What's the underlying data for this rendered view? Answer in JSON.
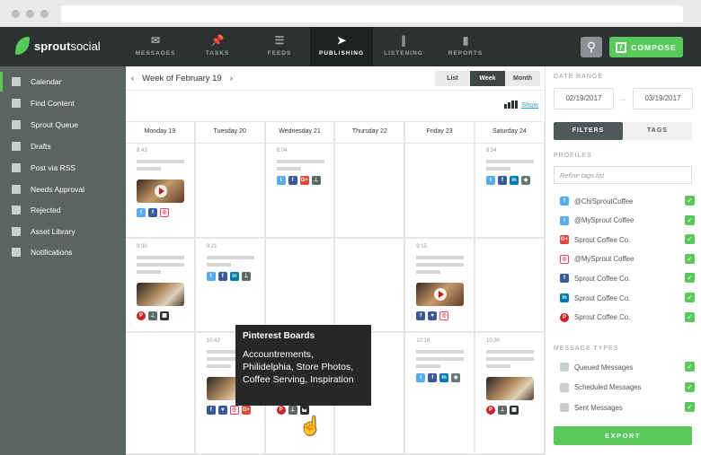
{
  "topnav": {
    "brand_a": "sprout",
    "brand_b": "social",
    "items": [
      {
        "label": "MESSAGES",
        "icon": "envelope-icon",
        "glyph": "✉"
      },
      {
        "label": "TASKS",
        "icon": "pin-icon",
        "glyph": "📌"
      },
      {
        "label": "FEEDS",
        "icon": "list-icon",
        "glyph": "☰"
      },
      {
        "label": "PUBLISHING",
        "icon": "paper-plane-icon",
        "glyph": "➤"
      },
      {
        "label": "LISTENING",
        "icon": "soundwave-icon",
        "glyph": "∥"
      },
      {
        "label": "REPORTS",
        "icon": "bar-chart-icon",
        "glyph": "▮"
      }
    ],
    "active": "PUBLISHING",
    "search_glyph": "⚲",
    "compose_label": "COMPOSE"
  },
  "sidebar": {
    "items": [
      {
        "label": "Calendar",
        "icon": "calendar-icon"
      },
      {
        "label": "Find Content",
        "icon": "binoculars-icon"
      },
      {
        "label": "Sprout Queue",
        "icon": "queue-icon"
      },
      {
        "label": "Drafts",
        "icon": "draft-icon"
      },
      {
        "label": "Post via RSS",
        "icon": "rss-icon"
      },
      {
        "label": "Needs Approval",
        "icon": "stamp-icon"
      },
      {
        "label": "Rejected",
        "icon": "rejected-icon"
      },
      {
        "label": "Asset Library",
        "icon": "library-icon"
      },
      {
        "label": "Notifications",
        "icon": "bell-icon"
      }
    ]
  },
  "calendar": {
    "prev": "‹",
    "next": "›",
    "title": "Week of February 19",
    "views": [
      "List",
      "Week",
      "Month"
    ],
    "active_view": "Week",
    "show_label": "Show",
    "days": [
      "Monday 19",
      "Tuesday 20",
      "Wednesday 21",
      "Thursday 22",
      "Friday 23",
      "Saturday 24"
    ],
    "posts": [
      {
        "day": 0,
        "row": 0,
        "time": "8:43",
        "lines": 2,
        "image": "video",
        "icons": [
          "twitter",
          "facebook",
          "instagram"
        ]
      },
      {
        "day": 2,
        "row": 0,
        "time": "8:04",
        "lines": 2,
        "image": null,
        "icons": [
          "twitter",
          "facebook",
          "googleplus",
          "approval"
        ]
      },
      {
        "day": 5,
        "row": 0,
        "time": "8:54",
        "lines": 2,
        "image": null,
        "icons": [
          "twitter",
          "facebook",
          "linkedin",
          "tag"
        ]
      },
      {
        "day": 0,
        "row": 1,
        "time": "9:30",
        "lines": 3,
        "image": "photo",
        "icons": [
          "pinterest",
          "approval",
          "boards"
        ]
      },
      {
        "day": 1,
        "row": 1,
        "time": "9:21",
        "lines": 2,
        "image": null,
        "icons": [
          "twitter",
          "facebook",
          "linkedin",
          "approval"
        ]
      },
      {
        "day": 4,
        "row": 1,
        "time": "9:15",
        "lines": 3,
        "image": "video",
        "icons": [
          "facebook",
          "vine",
          "instagram"
        ]
      },
      {
        "day": 1,
        "row": 2,
        "time": "10:43",
        "lines": 3,
        "image": "photo",
        "icons": [
          "facebook",
          "vine",
          "instagram",
          "googleplus"
        ]
      },
      {
        "day": 2,
        "row": 2,
        "time": "",
        "lines": 3,
        "image": "photo",
        "icons": [
          "pinterest",
          "approval",
          "boards"
        ]
      },
      {
        "day": 4,
        "row": 2,
        "time": "10:18",
        "lines": 3,
        "image": null,
        "icons": [
          "twitter",
          "facebook",
          "linkedin",
          "tag"
        ]
      },
      {
        "day": 5,
        "row": 2,
        "time": "10:30",
        "lines": 3,
        "image": "photo",
        "icons": [
          "pinterest",
          "approval",
          "boards"
        ]
      }
    ]
  },
  "tooltip": {
    "title": "Pinterest Boards",
    "body": "Accountrements, Philidelphia, Store Photos, Coffee Serving, Inspiration"
  },
  "filters": {
    "date_range_label": "DATE RANGE",
    "start_date": "02/19/2017",
    "end_date": "03/19/2017",
    "tabs": [
      "FILTERS",
      "TAGS"
    ],
    "active_tab": "FILTERS",
    "profiles_label": "PROFILES",
    "refine_placeholder": "Refine tags list",
    "profiles": [
      {
        "network": "twitter",
        "name": "@ChiSproutCoffee",
        "checked": true
      },
      {
        "network": "twitter",
        "name": "@MySprout Coffee",
        "checked": true
      },
      {
        "network": "googleplus",
        "name": "Sprout Coffee Co.",
        "checked": true
      },
      {
        "network": "instagram",
        "name": "@MySprout Coffee",
        "checked": true
      },
      {
        "network": "facebook",
        "name": "Sprout Coffee Co.",
        "checked": true
      },
      {
        "network": "linkedin",
        "name": "Sprout Coffee Co.",
        "checked": true
      },
      {
        "network": "pinterest",
        "name": "Sprout Coffee Co.",
        "checked": true
      }
    ],
    "message_types_label": "MESSAGE TYPES",
    "message_types": [
      {
        "label": "Queued Messages",
        "icon": "queue-icon",
        "checked": true
      },
      {
        "label": "Scheduled Messages",
        "icon": "calendar-19-icon",
        "checked": true
      },
      {
        "label": "Sent Messages",
        "icon": "sent-icon",
        "checked": true
      }
    ],
    "export_label": "EXPORT"
  },
  "colors": {
    "accent": "#59c95c",
    "twitter": "#55acee",
    "facebook": "#3b5998",
    "instagram": "#e4405f",
    "googleplus": "#dd4b39",
    "linkedin": "#0077b5",
    "pinterest": "#cb2027",
    "approval": "#5c6666",
    "tag": "#6b7575",
    "boards": "#2c3232",
    "vine": "#3b5998"
  }
}
